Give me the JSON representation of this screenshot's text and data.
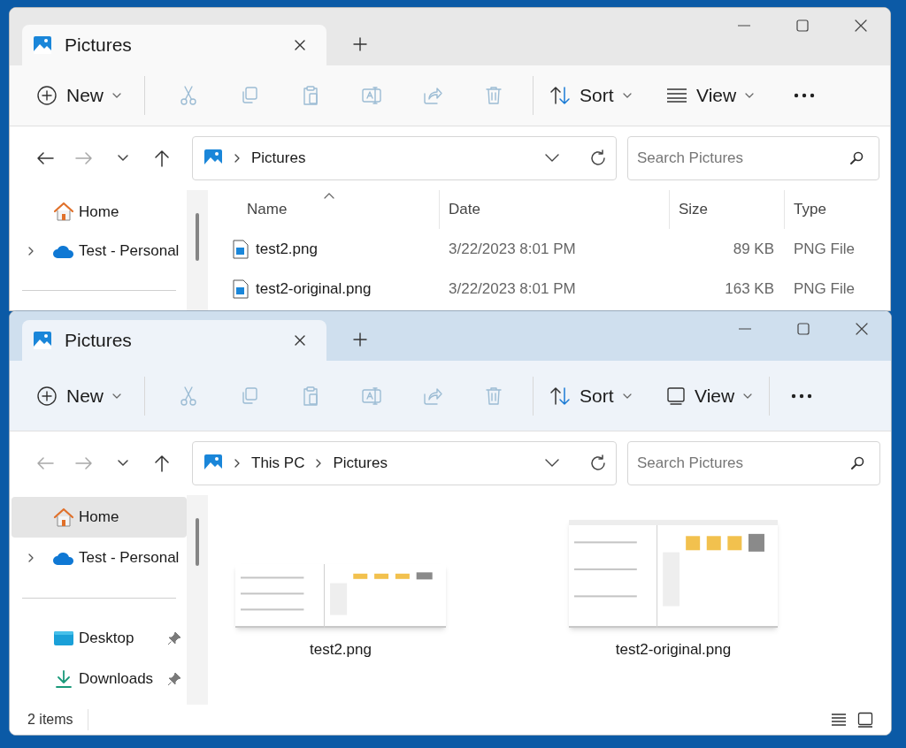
{
  "windows": [
    {
      "active": false,
      "tab_title": "Pictures",
      "toolbar": {
        "new": "New",
        "actions": [
          {
            "kind": "cut",
            "disabled": true
          },
          {
            "kind": "copy",
            "disabled": true
          },
          {
            "kind": "paste",
            "disabled": true
          },
          {
            "kind": "rename",
            "disabled": true
          },
          {
            "kind": "share",
            "disabled": true
          },
          {
            "kind": "delete",
            "disabled": true
          }
        ],
        "sort": "Sort",
        "view": {
          "label": "View",
          "kind": "list"
        }
      },
      "nav": {
        "back_disabled": false,
        "forward_disabled": true
      },
      "address": {
        "crumbs": [
          "Pictures"
        ]
      },
      "search": {
        "placeholder": "Search Pictures"
      },
      "sidebar": {
        "items": [
          {
            "kind": "home",
            "label": "Home",
            "selected": false,
            "expandable": false,
            "pinned": false
          },
          {
            "kind": "cloud",
            "label": "Test - Personal",
            "selected": false,
            "expandable": true,
            "pinned": false
          }
        ]
      },
      "content": {
        "kind": "details",
        "columns": [
          {
            "label": "Name",
            "sorted": true
          },
          {
            "label": "Date",
            "sorted": false
          },
          {
            "label": "Size",
            "sorted": false
          },
          {
            "label": "Type",
            "sorted": false
          }
        ],
        "rows": [
          {
            "name": "test2.png",
            "date": "3/22/2023 8:01 PM",
            "size": "89 KB",
            "type": "PNG File"
          },
          {
            "name": "test2-original.png",
            "date": "3/22/2023 8:01 PM",
            "size": "163 KB",
            "type": "PNG File"
          }
        ]
      }
    },
    {
      "active": true,
      "tab_title": "Pictures",
      "toolbar": {
        "new": "New",
        "actions": [
          {
            "kind": "cut",
            "disabled": true
          },
          {
            "kind": "copy",
            "disabled": true
          },
          {
            "kind": "paste",
            "disabled": true
          },
          {
            "kind": "rename",
            "disabled": true
          },
          {
            "kind": "share",
            "disabled": true
          },
          {
            "kind": "delete",
            "disabled": true
          }
        ],
        "sort": "Sort",
        "view": {
          "label": "View",
          "kind": "pane"
        }
      },
      "nav": {
        "back_disabled": true,
        "forward_disabled": true
      },
      "address": {
        "crumbs": [
          "This PC",
          "Pictures"
        ]
      },
      "search": {
        "placeholder": "Search Pictures"
      },
      "sidebar": {
        "items": [
          {
            "kind": "home",
            "label": "Home",
            "selected": true,
            "expandable": false,
            "pinned": false
          },
          {
            "kind": "cloud",
            "label": "Test - Personal",
            "selected": false,
            "expandable": true,
            "pinned": false
          },
          {
            "kind": "desktop",
            "label": "Desktop",
            "selected": false,
            "expandable": false,
            "pinned": true
          },
          {
            "kind": "downloads",
            "label": "Downloads",
            "selected": false,
            "expandable": false,
            "pinned": true
          }
        ]
      },
      "content": {
        "kind": "icons",
        "items": [
          {
            "name": "test2.png",
            "kind": "picture"
          },
          {
            "name": "test2-original.png",
            "kind": "picture"
          }
        ]
      },
      "status_bar": {
        "count": "2 items"
      }
    }
  ]
}
